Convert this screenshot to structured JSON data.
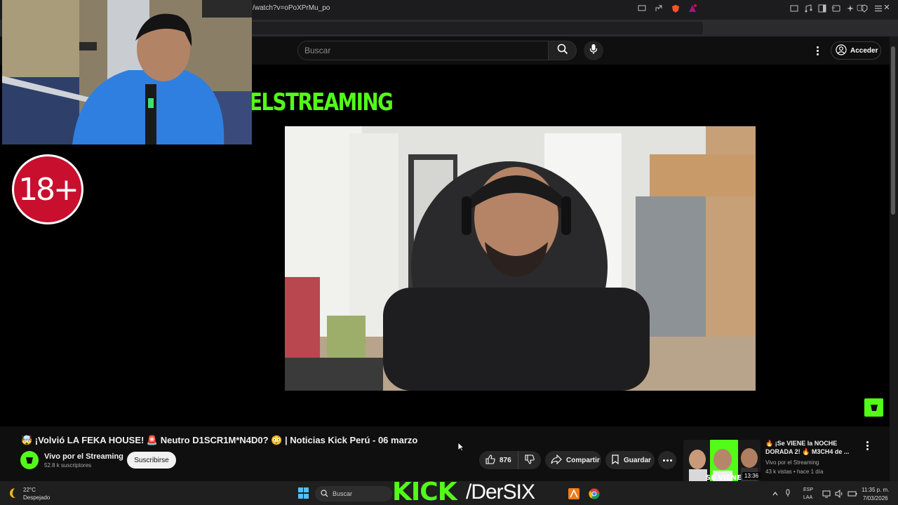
{
  "browser": {
    "url": "/watch?v=oPoXPrMu_po",
    "window_controls": [
      "–",
      "▢",
      "✕"
    ]
  },
  "header": {
    "search_placeholder": "Buscar",
    "signin_label": "Acceder"
  },
  "player": {
    "brand_text": "ELSTREAMING",
    "age_badge": "18+"
  },
  "video": {
    "title": "🤯 ¡Volvió LA FEKA HOUSE! 🚨 Neutro D1SCR1M*N4D0? 😳 | Noticias Kick Perú - 06 marzo",
    "channel_name": "Vivo por el Streaming",
    "subscribers": "52.8 k suscriptores",
    "subscribe_label": "Suscribirse",
    "likes": "876",
    "share_label": "Compartir",
    "save_label": "Guardar"
  },
  "recommendation": {
    "title": "🔥 ¡Se VIENE la NOCHE DORADA 2! 🔥 M3CH4 de ...",
    "channel": "Vivo por el Streaming",
    "meta": "43 k vistas • hace 1 día",
    "duration": "13:36",
    "thumb_text": "SE VIENE"
  },
  "taskbar": {
    "weather_temp": "22°C",
    "weather_desc": "Despejado",
    "search_label": "Buscar",
    "overlay_kick": "KICK",
    "overlay_handle": "/DerSIX",
    "lang_1": "ESP",
    "lang_2": "LAA",
    "time": "11:35 p. m.",
    "date": "7/03/2026"
  },
  "colors": {
    "kick_green": "#53fc18",
    "badge_red": "#c8102e",
    "yt_bg": "#0f0f0f"
  }
}
